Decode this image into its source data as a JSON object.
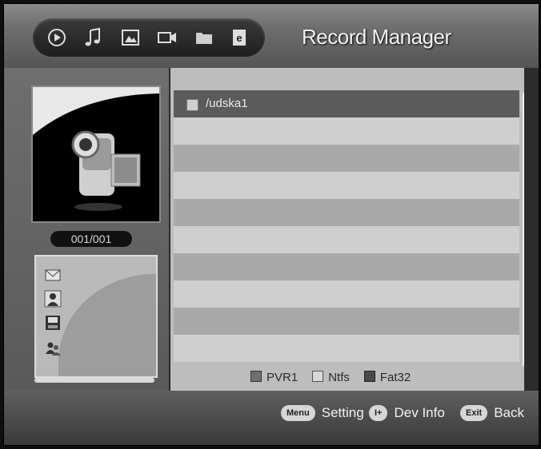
{
  "header": {
    "title": "Record Manager",
    "icons": [
      "play-circle-icon",
      "music-note-icon",
      "photo-icon",
      "camera-icon",
      "folder-icon",
      "ebook-icon"
    ]
  },
  "sidebar": {
    "counter": "001/001",
    "detail_icons": [
      "mail-icon",
      "person-icon",
      "disk-icon",
      "user-group-icon"
    ]
  },
  "file_list": {
    "items": [
      "/udska1",
      "",
      "",
      "",
      "",
      "",
      "",
      "",
      "",
      ""
    ],
    "selected_index": 0
  },
  "legend": [
    {
      "label": "PVR1",
      "color": "#6f6f6f"
    },
    {
      "label": "Ntfs",
      "color": "#d8d8d8"
    },
    {
      "label": "Fat32",
      "color": "#4a4a4a"
    }
  ],
  "footer": {
    "hints": [
      {
        "key": "Menu",
        "label": "Setting"
      },
      {
        "key": "I+",
        "label": "Dev Info"
      },
      {
        "key": "Exit",
        "label": "Back"
      }
    ]
  }
}
